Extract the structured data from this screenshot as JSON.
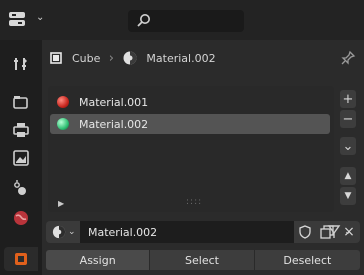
{
  "header": {
    "editor_type_icon": "properties-editor-icon",
    "search_icon": "search-icon",
    "search_value": ""
  },
  "sidebar_tabs": [
    {
      "name": "tool",
      "icon": "tool-settings-icon"
    },
    {
      "name": "render",
      "icon": "render-icon"
    },
    {
      "name": "output",
      "icon": "printer-output-icon"
    },
    {
      "name": "view-layer",
      "icon": "image-view-layer-icon"
    },
    {
      "name": "scene",
      "icon": "scene-icon"
    },
    {
      "name": "world",
      "icon": "world-icon"
    },
    {
      "name": "material",
      "icon": "material-icon",
      "active": true
    }
  ],
  "breadcrumb": {
    "object": "Cube",
    "material": "Material.002"
  },
  "material_slots": [
    {
      "name": "Material.001",
      "color": "#c8261e",
      "selected": false
    },
    {
      "name": "Material.002",
      "color": "#2fbf73",
      "selected": true
    }
  ],
  "slot_buttons": {
    "add": "+",
    "remove": "−",
    "specials": "⌄",
    "move_up": "▲",
    "move_down": "▼"
  },
  "material_selector": {
    "value": "Material.002"
  },
  "actions": {
    "assign": "Assign",
    "select": "Select",
    "deselect": "Deselect"
  },
  "colors": {
    "background": "#2b2b2b",
    "header": "#232323",
    "selected_row": "#545454",
    "material_tab_accent": "#e0601c"
  }
}
